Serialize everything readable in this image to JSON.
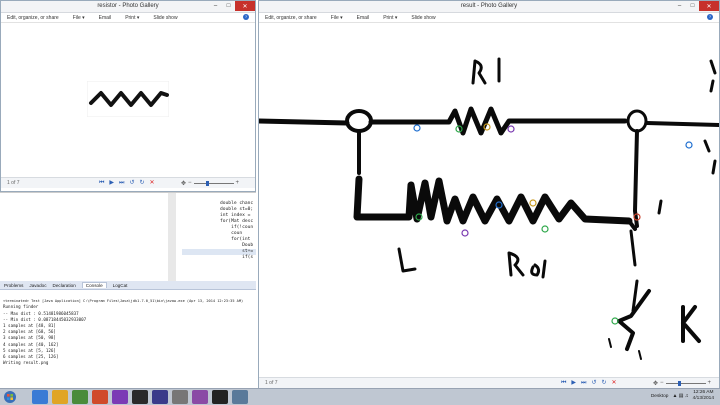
{
  "left_window": {
    "title": "resistor - Photo Gallery",
    "menu": [
      "Edit, organize, or share",
      "File ▾",
      "Email",
      "Print ▾",
      "Slide show"
    ],
    "help": "?",
    "counter": "1 of 7"
  },
  "right_window": {
    "title": "result - Photo Gallery",
    "menu": [
      "Edit, organize, or share",
      "File ▾",
      "Email",
      "Print ▾",
      "Slide show"
    ],
    "help": "?",
    "counter": "1 of 7",
    "sketch_labels": [
      "R1",
      "L",
      "R2",
      "k"
    ]
  },
  "window_buttons": {
    "minimize": "–",
    "maximize": "□",
    "close": "✕"
  },
  "code_editor": {
    "lines": [
      "double chanc",
      "double st=0;",
      "int index =",
      "for(Mat desc",
      "    if(!coun",
      "    coun",
      "    for(int",
      "        Doub",
      "        st+=",
      "        if(s"
    ]
  },
  "ide_panel": {
    "tabs": [
      "Problems",
      "Javadoc",
      "Declaration",
      "Console",
      "LogCat"
    ],
    "active_tab": "Console",
    "console_lines": [
      "<terminated> Test [Java Application] C:\\Program Files\\Java\\jdk1.7.0_51\\bin\\javaw.exe (Apr 13, 2014 12:23:35 AM)",
      "Running finder",
      "-- Max dist : 0.51481986045837",
      "-- Min dist : 0.08718445032933007",
      "1 samples at [48, 81]",
      "2 samples at [68, 56]",
      "3 samples at [50, 98]",
      "4 samples at [40, 162]",
      "5 samples at [5, 126]",
      "6 samples at [25, 126]",
      "Writing result.png"
    ]
  },
  "taskbar": {
    "desktop_label": "Desktop",
    "time": "12:26 AM",
    "date": "4/13/2014",
    "icon_colors": [
      "#3a7bd5",
      "#e0a526",
      "#4a8b3a",
      "#d04a2a",
      "#7b3ab5",
      "#2a2a2a",
      "#3a3a8a",
      "#777777",
      "#8a4aa5",
      "#222222",
      "#5a7a9a"
    ]
  },
  "colors": {
    "accent": "#2c5fb4",
    "close": "#c7312b"
  }
}
